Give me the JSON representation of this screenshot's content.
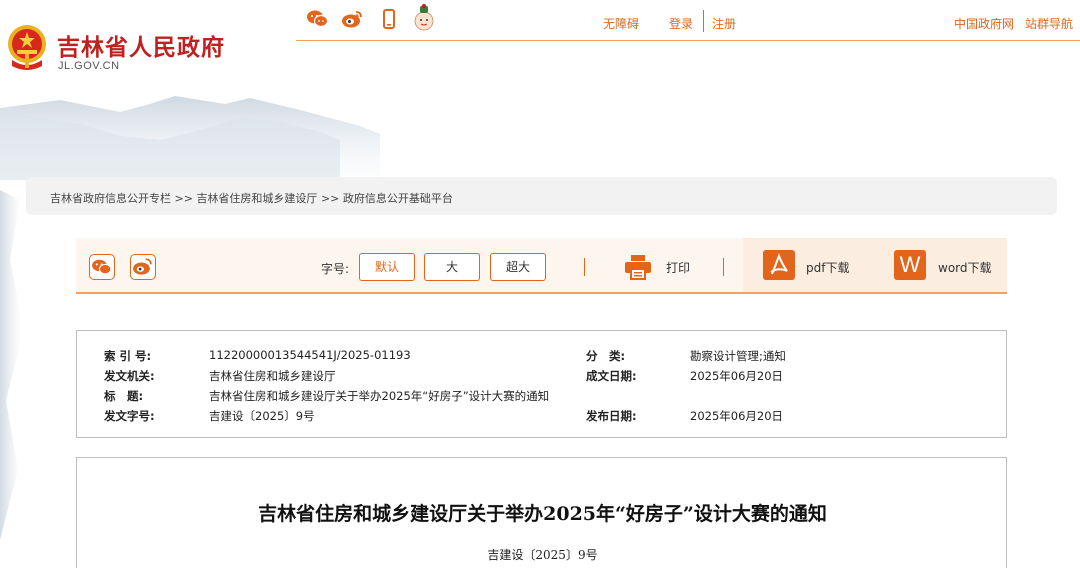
{
  "header": {
    "site_title": "吉林省人民政府",
    "site_domain": "JL.GOV.CN",
    "social": [
      "wechat-icon",
      "weibo-icon",
      "mobile-icon",
      "mascot-icon"
    ],
    "links": {
      "accessibility": "无障碍",
      "login": "登录",
      "register": "注册",
      "gov_portal": "中国政府网",
      "site_nav": "站群导航"
    }
  },
  "breadcrumb": {
    "items": [
      "吉林省政府信息公开专栏",
      "吉林省住房和城乡建设厅",
      "政府信息公开基础平台"
    ],
    "separator": ">>"
  },
  "toolbar": {
    "font_label": "字号:",
    "sizes": [
      "默认",
      "大",
      "超大"
    ],
    "active_size": "默认",
    "print_label": "打印",
    "pdf_label": "pdf下载",
    "word_label": "word下载",
    "word_icon_letter": "W"
  },
  "meta": {
    "index_no_label": "索 引 号:",
    "index_no": "11220000013544541J/2025-01193",
    "category_label": "分　类:",
    "category": "勘察设计管理;通知",
    "issuer_label": "发文机关:",
    "issuer": "吉林省住房和城乡建设厅",
    "created_label": "成文日期:",
    "created": "2025年06月20日",
    "title_label": "标　题:",
    "title": "吉林省住房和城乡建设厅关于举办2025年“好房子”设计大赛的通知",
    "docno_label": "发文字号:",
    "docno": "吉建设〔2025〕9号",
    "published_label": "发布日期:",
    "published": "2025年06月20日"
  },
  "article": {
    "title": "吉林省住房和城乡建设厅关于举办2025年“好房子”设计大赛的通知",
    "docno": "吉建设〔2025〕9号"
  },
  "colors": {
    "brand_red": "#c0201f",
    "accent_orange": "#e2651b",
    "line_orange": "#f3a15b"
  }
}
